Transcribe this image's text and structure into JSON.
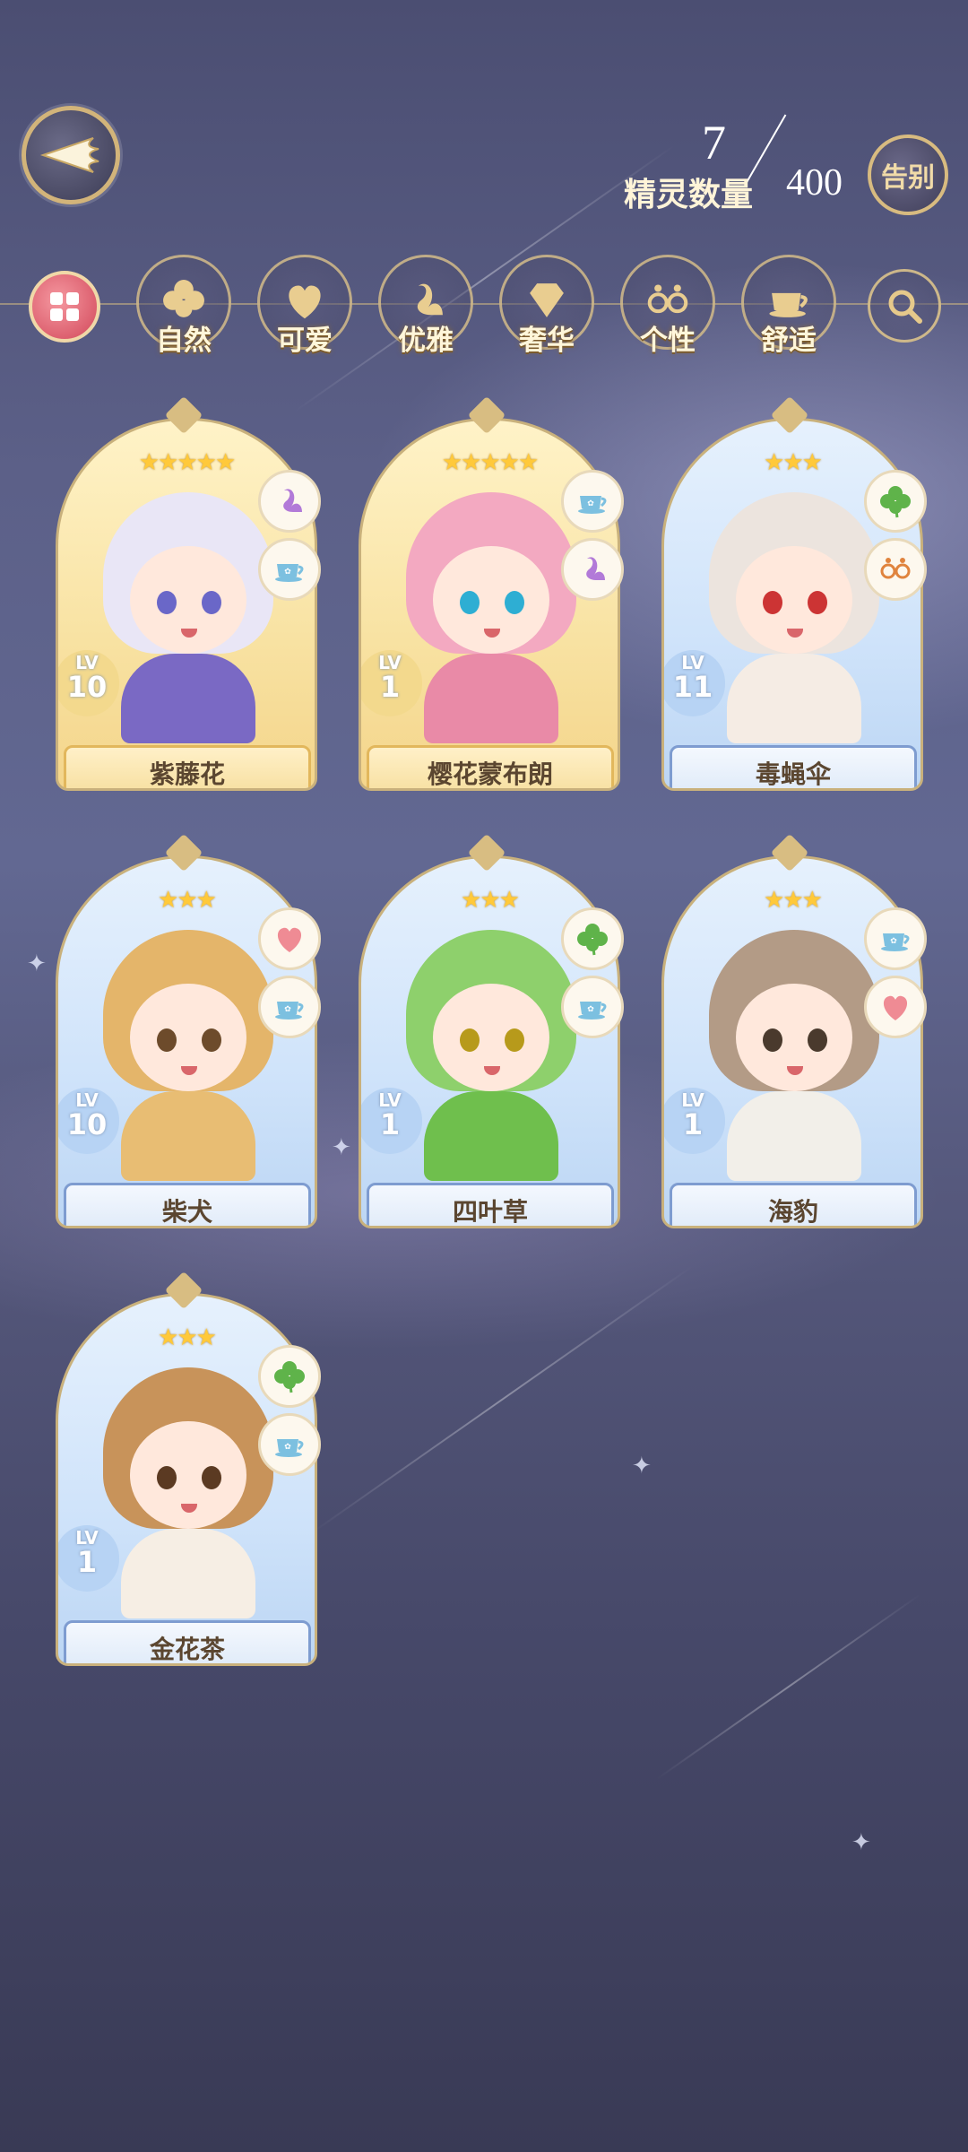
{
  "header": {
    "spirit_count_label": "精灵数量",
    "spirit_count_current": "7",
    "spirit_count_max": "400",
    "farewell_label": "告别"
  },
  "categories": [
    {
      "label": "自然",
      "icon": "clover-icon"
    },
    {
      "label": "可爱",
      "icon": "heart-icon"
    },
    {
      "label": "优雅",
      "icon": "swan-icon"
    },
    {
      "label": "奢华",
      "icon": "diamond-icon"
    },
    {
      "label": "个性",
      "icon": "glasses-icon"
    },
    {
      "label": "舒适",
      "icon": "teacup-icon"
    }
  ],
  "spirits": [
    {
      "name": "紫藤花",
      "level": "10",
      "stars": "★★★★★",
      "rarity": "gold",
      "tags": [
        "swan-icon",
        "teacup-icon"
      ],
      "hair_color": "#e9e6f6",
      "eye_color": "#6a67c8",
      "outfit_color": "#7a69c4"
    },
    {
      "name": "樱花蒙布朗",
      "level": "1",
      "stars": "★★★★★",
      "rarity": "gold",
      "tags": [
        "teacup-icon",
        "swan-icon"
      ],
      "hair_color": "#f3a9c1",
      "eye_color": "#2eaed3",
      "outfit_color": "#e98aa7"
    },
    {
      "name": "毒蝇伞",
      "level": "11",
      "stars": "★★★",
      "rarity": "blue",
      "tags": [
        "clover-icon",
        "glasses-icon"
      ],
      "hair_color": "#ece4de",
      "eye_color": "#cc3434",
      "outfit_color": "#f5ece4"
    },
    {
      "name": "柴犬",
      "level": "10",
      "stars": "★★★",
      "rarity": "blue",
      "tags": [
        "heart-icon",
        "teacup-icon"
      ],
      "hair_color": "#e4b56a",
      "eye_color": "#6d4b2b",
      "outfit_color": "#e8bd73"
    },
    {
      "name": "四叶草",
      "level": "1",
      "stars": "★★★",
      "rarity": "blue",
      "tags": [
        "clover-icon",
        "teacup-icon"
      ],
      "hair_color": "#8ed06c",
      "eye_color": "#b79a1b",
      "outfit_color": "#6fbf4d"
    },
    {
      "name": "海豹",
      "level": "1",
      "stars": "★★★",
      "rarity": "blue",
      "tags": [
        "teacup-icon",
        "heart-icon"
      ],
      "hair_color": "#b39b86",
      "eye_color": "#4a3a2d",
      "outfit_color": "#f2efe9"
    },
    {
      "name": "金花茶",
      "level": "1",
      "stars": "★★★",
      "rarity": "blue",
      "tags": [
        "clover-icon",
        "teacup-icon"
      ],
      "hair_color": "#c8935a",
      "eye_color": "#5b3a22",
      "outfit_color": "#f6eee4"
    }
  ]
}
